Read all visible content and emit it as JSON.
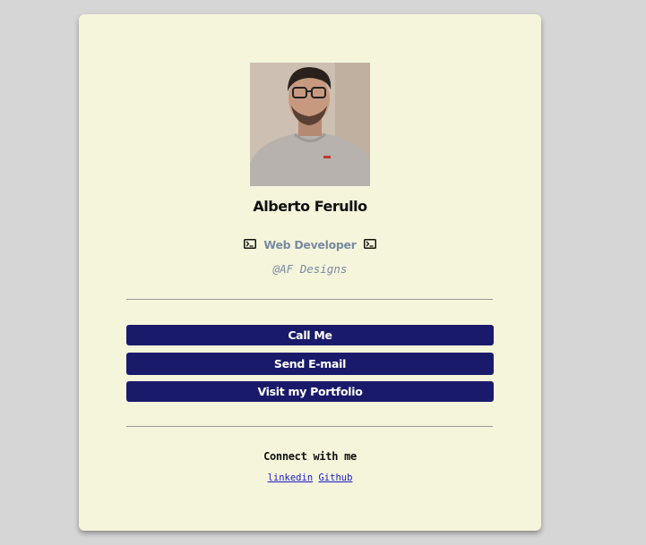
{
  "profile": {
    "name": "Alberto Ferullo",
    "role": "Web Developer",
    "company": "@AF Designs"
  },
  "actions": {
    "call": "Call Me",
    "email": "Send E-mail",
    "portfolio": "Visit my Portfolio"
  },
  "social": {
    "heading": "Connect with me",
    "links": [
      "linkedin",
      "Github"
    ]
  },
  "icons": {
    "role_prefix": "terminal-icon",
    "role_suffix": "terminal-icon"
  },
  "colors": {
    "page_bg": "#d6d6d6",
    "card_bg": "#f5f5dc",
    "button_bg": "#1a1a6b",
    "muted_text": "#7a8aa0",
    "link": "#1a1acc"
  }
}
